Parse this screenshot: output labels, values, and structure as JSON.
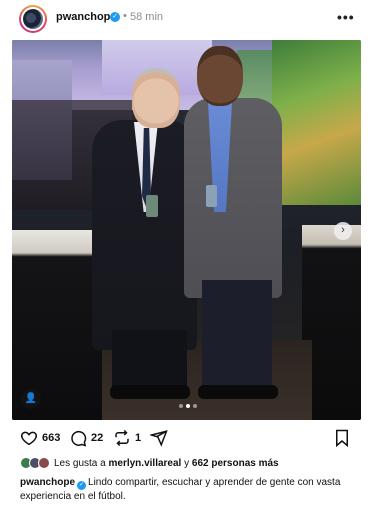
{
  "post": {
    "username": "pwanchope",
    "time_sep": "•",
    "time": "58 min",
    "more_icon": "more-horizontal-icon",
    "verified_icon": "verified-badge-icon"
  },
  "photo": {
    "carousel_total": 3,
    "carousel_active": 1
  },
  "actions": {
    "like_count": "663",
    "comment_count": "22",
    "repost_count": "1"
  },
  "likes": {
    "prefix": "Les gusta a",
    "user": "merlyn.villareal",
    "middle": "y",
    "others": "662 personas más"
  },
  "caption": {
    "username": "pwanchope",
    "text": "Lindo compartir, escuchar y aprender de gente con vasta experiencia en el fútbol."
  },
  "colors": {
    "accent_verified": "#1d9bf0",
    "muted_text": "#8e8e8e"
  }
}
